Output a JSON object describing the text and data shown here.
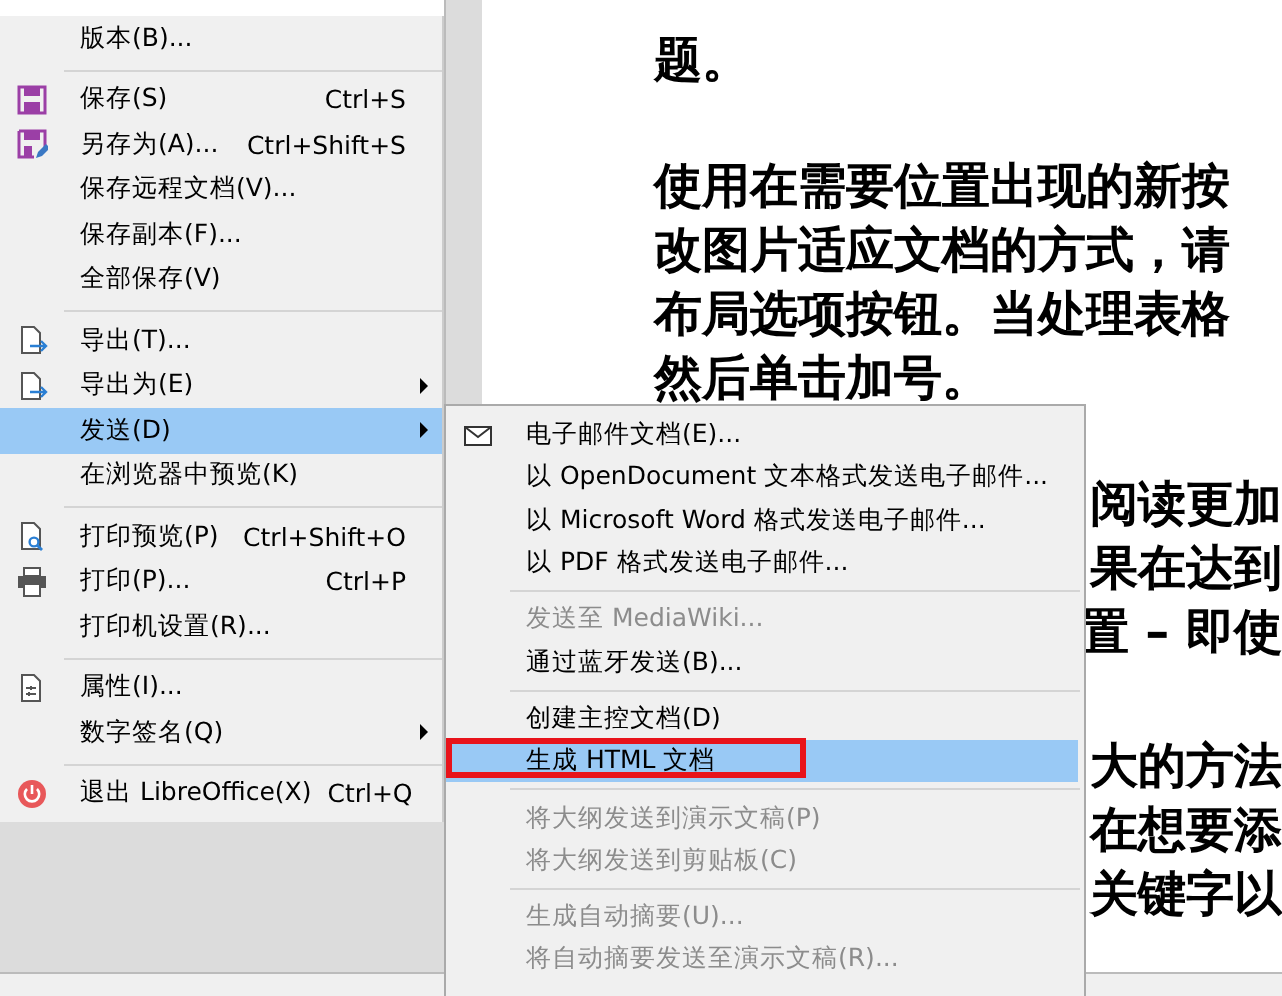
{
  "file_menu": [
    {
      "kind": "item",
      "label": "版本(B)...",
      "disabled": false,
      "selected": false
    },
    {
      "kind": "separator"
    },
    {
      "kind": "item",
      "label": "保存(S)",
      "shortcut": "Ctrl+S",
      "disabled": false,
      "selected": false
    },
    {
      "kind": "item",
      "label": "另存为(A)...",
      "shortcut": "Ctrl+Shift+S",
      "disabled": false,
      "selected": false
    },
    {
      "kind": "item",
      "label": "保存远程文档(V)...",
      "disabled": false,
      "selected": false
    },
    {
      "kind": "item",
      "label": "保存副本(F)...",
      "disabled": false,
      "selected": false
    },
    {
      "kind": "item",
      "label": "全部保存(V)",
      "disabled": false,
      "selected": false
    },
    {
      "kind": "separator"
    },
    {
      "kind": "item",
      "label": "导出(T)...",
      "disabled": false,
      "selected": false
    },
    {
      "kind": "item",
      "label": "导出为(E)",
      "submenu": true,
      "disabled": false,
      "selected": false
    },
    {
      "kind": "item",
      "label": "发送(D)",
      "submenu": true,
      "disabled": false,
      "selected": true
    },
    {
      "kind": "item",
      "label": "在浏览器中预览(K)",
      "disabled": false,
      "selected": false
    },
    {
      "kind": "separator"
    },
    {
      "kind": "item",
      "label": "打印预览(P)",
      "shortcut": "Ctrl+Shift+O",
      "disabled": false,
      "selected": false
    },
    {
      "kind": "item",
      "label": "打印(P)...",
      "shortcut": "Ctrl+P",
      "disabled": false,
      "selected": false
    },
    {
      "kind": "item",
      "label": "打印机设置(R)...",
      "disabled": false,
      "selected": false
    },
    {
      "kind": "separator"
    },
    {
      "kind": "item",
      "label": "属性(I)...",
      "disabled": false,
      "selected": false
    },
    {
      "kind": "item",
      "label": "数字签名(Q)",
      "submenu": true,
      "disabled": false,
      "selected": false
    },
    {
      "kind": "separator"
    },
    {
      "kind": "item",
      "label": "退出 LibreOffice(X)",
      "shortcut": "Ctrl+Q",
      "disabled": false,
      "selected": false
    }
  ],
  "send_submenu": [
    {
      "kind": "item",
      "label": "电子邮件文档(E)...",
      "disabled": false,
      "selected": false,
      "marked": false
    },
    {
      "kind": "item",
      "label": "以 OpenDocument 文本格式发送电子邮件...",
      "disabled": false,
      "selected": false,
      "marked": false
    },
    {
      "kind": "item",
      "label": "以 Microsoft Word 格式发送电子邮件...",
      "disabled": false,
      "selected": false,
      "marked": false
    },
    {
      "kind": "item",
      "label": "以 PDF 格式发送电子邮件...",
      "disabled": false,
      "selected": false,
      "marked": false
    },
    {
      "kind": "separator"
    },
    {
      "kind": "item",
      "label": "发送至 MediaWiki...",
      "disabled": true,
      "selected": false,
      "marked": false
    },
    {
      "kind": "item",
      "label": "通过蓝牙发送(B)...",
      "disabled": false,
      "selected": false,
      "marked": false
    },
    {
      "kind": "separator"
    },
    {
      "kind": "item",
      "label": "创建主控文档(D)",
      "disabled": false,
      "selected": false,
      "marked": false
    },
    {
      "kind": "item",
      "label": "生成 HTML 文档",
      "disabled": false,
      "selected": true,
      "marked": true
    },
    {
      "kind": "separator"
    },
    {
      "kind": "item",
      "label": "将大纲发送到演示文稿(P)",
      "disabled": true,
      "selected": false,
      "marked": false
    },
    {
      "kind": "item",
      "label": "将大纲发送到剪贴板(C)",
      "disabled": true,
      "selected": false,
      "marked": false
    },
    {
      "kind": "separator"
    },
    {
      "kind": "item",
      "label": "生成自动摘要(U)...",
      "disabled": true,
      "selected": false,
      "marked": false
    },
    {
      "kind": "item",
      "label": "将自动摘要发送至演示文稿(R)...",
      "disabled": true,
      "selected": false,
      "marked": false
    }
  ],
  "document": {
    "paragraphs": [
      {
        "kind": "full",
        "lines": [
          "题。"
        ]
      },
      {
        "kind": "full",
        "lines": [
          "使用在需要位置出现的新按",
          "改图片适应文档的方式，请",
          "布局选项按钮。当处理表格",
          "然后单击加号。"
        ]
      },
      {
        "kind": "partial",
        "lines": [
          "阅读更加",
          "果在达到",
          "置 – 即使"
        ]
      },
      {
        "kind": "partial",
        "lines": [
          "大的方法",
          "在想要添",
          "关键字以"
        ]
      }
    ]
  }
}
